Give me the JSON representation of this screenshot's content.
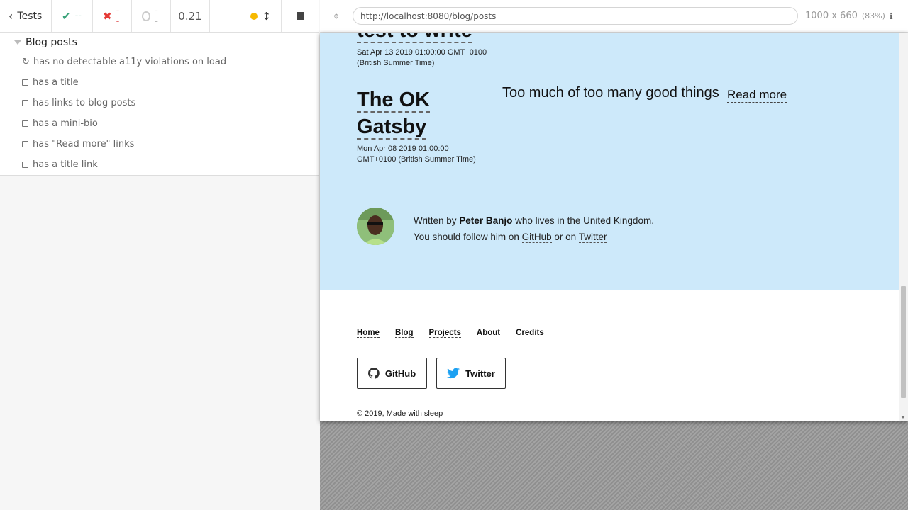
{
  "runner": {
    "back_label": "Tests",
    "passed": "--",
    "failed": "--",
    "pending": "--",
    "duration": "0.21",
    "suite_title": "Blog posts",
    "tests": [
      {
        "label": "has no detectable a11y violations on load",
        "state": "running"
      },
      {
        "label": "has a title",
        "state": "queued"
      },
      {
        "label": "has links to blog posts",
        "state": "queued"
      },
      {
        "label": "has a mini-bio",
        "state": "queued"
      },
      {
        "label": "has \"Read more\" links",
        "state": "queued"
      },
      {
        "label": "has a title link",
        "state": "queued"
      }
    ]
  },
  "preview": {
    "url": "http://localhost:8080/blog/posts",
    "viewport": "1000 x 660",
    "scale": "(83%)"
  },
  "page": {
    "post1": {
      "title_fragment": "test to write",
      "date_line1": "Sat Apr 13 2019 01:00:00 GMT+0100",
      "date_line2": "(British Summer Time)"
    },
    "post2": {
      "title_line1": "The OK",
      "title_line2": "Gatsby",
      "date_line1": "Mon Apr 08 2019 01:00:00",
      "date_line2": "GMT+0100 (British Summer Time)",
      "description": "Too much of too many good things",
      "read_more": "Read more"
    },
    "bio": {
      "prefix": "Written by",
      "author": "Peter Banjo",
      "suffix": "who lives in the United Kingdom.",
      "follow_prefix": "You should follow him on",
      "github": "GitHub",
      "or_on": "or on",
      "twitter": "Twitter"
    },
    "footer": {
      "nav": {
        "home": "Home",
        "blog": "Blog",
        "projects": "Projects",
        "about": "About",
        "credits": "Credits"
      },
      "github_button": "GitHub",
      "twitter_button": "Twitter",
      "copyright": "© 2019, Made with sleep"
    }
  },
  "colors": {
    "accent_blue_bg": "#cde9fa",
    "pass_green": "#8bc34a",
    "fail_red": "#e53935",
    "running_yellow": "#f6b900",
    "twitter_blue": "#1da1f2"
  }
}
